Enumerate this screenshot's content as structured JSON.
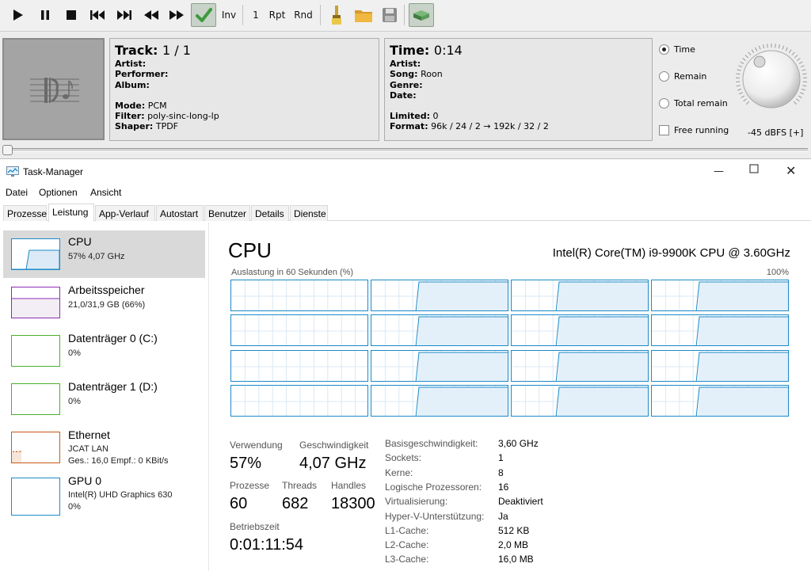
{
  "player": {
    "toolbar": {
      "inv_label": "Inv",
      "count_label": "1",
      "rpt_label": "Rpt",
      "rnd_label": "Rnd"
    },
    "track": {
      "title_label": "Track:",
      "title_value": "1 / 1",
      "rows1": [
        {
          "label": "Artist:",
          "value": ""
        },
        {
          "label": "Performer:",
          "value": ""
        },
        {
          "label": "Album:",
          "value": ""
        }
      ],
      "rows2": [
        {
          "label": "Mode:",
          "value": "PCM"
        },
        {
          "label": "Filter:",
          "value": "poly-sinc-long-lp"
        },
        {
          "label": "Shaper:",
          "value": "TPDF"
        }
      ]
    },
    "time": {
      "title_label": "Time:",
      "title_value": "0:14",
      "rows1": [
        {
          "label": "Artist:",
          "value": ""
        },
        {
          "label": "Song:",
          "value": "Roon"
        },
        {
          "label": "Genre:",
          "value": ""
        },
        {
          "label": "Date:",
          "value": ""
        }
      ],
      "rows2": [
        {
          "label": "Limited:",
          "value": "0"
        },
        {
          "label": "Format:",
          "value": "96k / 24 / 2 → 192k / 32 / 2"
        }
      ]
    },
    "display_options": {
      "time": "Time",
      "remain": "Remain",
      "total_remain": "Total remain",
      "free_running": "Free running",
      "selected": "time"
    },
    "volume_label": "-45 dBFS [+]"
  },
  "taskmanager": {
    "title": "Task-Manager",
    "menu": [
      "Datei",
      "Optionen",
      "Ansicht"
    ],
    "tabs": [
      "Prozesse",
      "Leistung",
      "App-Verlauf",
      "Autostart",
      "Benutzer",
      "Details",
      "Dienste"
    ],
    "active_tab": "Leistung",
    "sidebar": [
      {
        "name": "CPU",
        "sub1": "57% 4,07 GHz",
        "sub2": "",
        "color": "#1c8ac8"
      },
      {
        "name": "Arbeitsspeicher",
        "sub1": "21,0/31,9 GB (66%)",
        "sub2": "",
        "color": "#8b2bb5"
      },
      {
        "name": "Datenträger 0 (C:)",
        "sub1": "0%",
        "sub2": "",
        "color": "#4caf2c"
      },
      {
        "name": "Datenträger 1 (D:)",
        "sub1": "0%",
        "sub2": "",
        "color": "#4caf2c"
      },
      {
        "name": "Ethernet",
        "sub1": "JCAT LAN",
        "sub2": "Ges.: 16,0 Empf.: 0 KBit/s",
        "color": "#c85a14"
      },
      {
        "name": "GPU 0",
        "sub1": "Intel(R) UHD Graphics 630",
        "sub2": "0%",
        "color": "#1c8ac8"
      }
    ],
    "cpu": {
      "title": "CPU",
      "model": "Intel(R) Core(TM) i9-9900K CPU @ 3.60GHz",
      "graph_label": "Auslastung in 60 Sekunden (%)",
      "graph_max": "100%",
      "stats": {
        "verwendung_label": "Verwendung",
        "verwendung_value": "57%",
        "geschw_label": "Geschwindigkeit",
        "geschw_value": "4,07 GHz",
        "prozesse_label": "Prozesse",
        "prozesse_value": "60",
        "threads_label": "Threads",
        "threads_value": "682",
        "handles_label": "Handles",
        "handles_value": "18300",
        "betrieb_label": "Betriebszeit",
        "betrieb_value": "0:01:11:54"
      },
      "properties": [
        {
          "key": "Basisgeschwindigkeit:",
          "value": "3,60 GHz"
        },
        {
          "key": "Sockets:",
          "value": "1"
        },
        {
          "key": "Kerne:",
          "value": "8"
        },
        {
          "key": "Logische Prozessoren:",
          "value": "16"
        },
        {
          "key": "Virtualisierung:",
          "value": "Deaktiviert"
        },
        {
          "key": "Hyper-V-Unterstützung:",
          "value": "Ja"
        },
        {
          "key": "L1-Cache:",
          "value": "512 KB"
        },
        {
          "key": "L2-Cache:",
          "value": "2,0 MB"
        },
        {
          "key": "L3-Cache:",
          "value": "16,0 MB"
        }
      ]
    }
  }
}
